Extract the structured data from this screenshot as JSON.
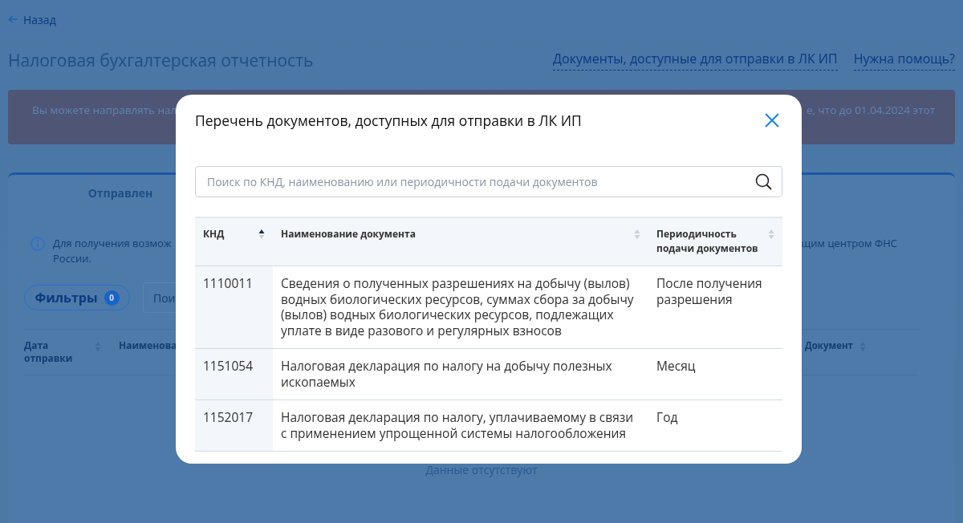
{
  "page": {
    "back_link": "Назад",
    "title": "Налоговая бухгалтерская отчетность",
    "header_links": [
      "Документы, доступные для отправки в ЛК ИП",
      "Нужна помощь?"
    ],
    "banner": {
      "text_left": "Вы можете направлять нал",
      "text_right": "е, что до 01.04.2024 этот"
    },
    "tabs": [
      {
        "label": "Отправлен",
        "selected": true
      }
    ],
    "info": {
      "lines_left": [
        "Для получения возмож",
        "России."
      ],
      "text_right": "щим центром ФНС"
    },
    "filters_button": {
      "label": "Фильтры",
      "count": "0"
    },
    "search": {
      "placeholder": "Пои"
    },
    "table": {
      "columns": [
        {
          "label": "Дата отправки",
          "sorted": false
        },
        {
          "label": "Наименова"
        },
        {
          "label": "Документ",
          "sorted": false
        }
      ],
      "empty_text": "Данные отсутствуют"
    }
  },
  "modal": {
    "title": "Перечень документов, доступных для отправки в ЛК ИП",
    "search": {
      "placeholder": "Поиск по КНД, наименованию или периодичности подачи документов"
    },
    "table": {
      "columns": [
        {
          "label": "КНД",
          "sorted": true
        },
        {
          "label": "Наименование документа",
          "sorted": false
        },
        {
          "label": "Периодичность подачи документов",
          "sorted": false
        }
      ],
      "rows": [
        {
          "knd": "1110011",
          "name": "Сведения о полученных разрешениях на добычу (вылов) водных биологических ресурсов, суммах сбора за добычу (вылов) водных биологических ресурсов, подлежащих уплате в виде разового и регулярных взносов",
          "period": "После получения разрешения"
        },
        {
          "knd": "1151054",
          "name": "Налоговая декларация по налогу на добычу полезных ископаемых",
          "period": "Месяц"
        },
        {
          "knd": "1152017",
          "name": "Налоговая декларация по налогу, уплачиваемому в связи с применением упрощенной системы налогообложения",
          "period": "Год"
        }
      ]
    }
  }
}
